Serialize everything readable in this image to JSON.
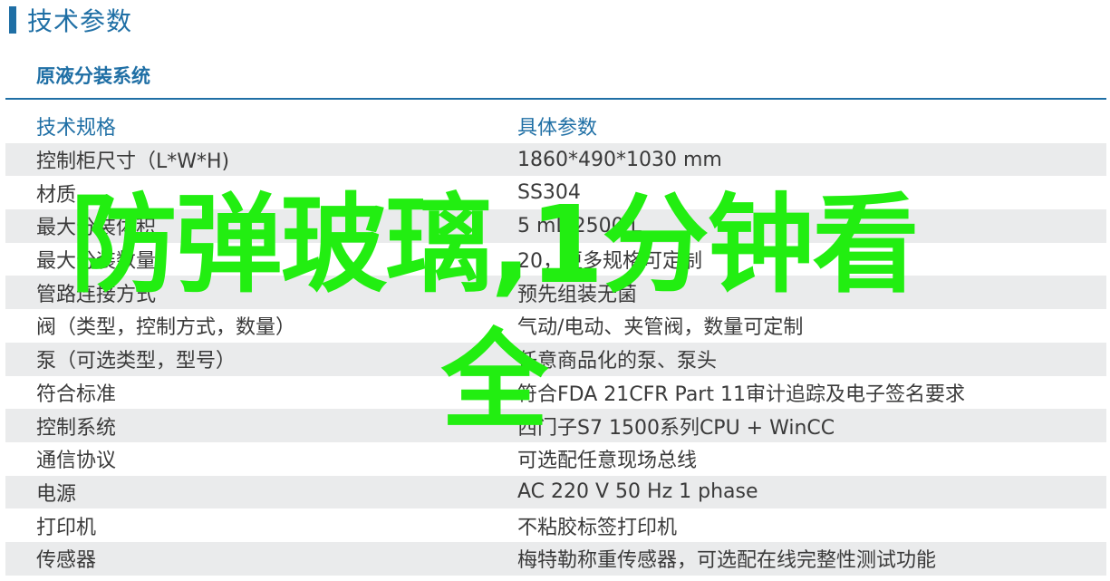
{
  "header": {
    "title": "技术参数"
  },
  "section": {
    "title": "原液分装系统"
  },
  "table": {
    "columns": [
      "技术规格",
      "具体参数"
    ],
    "rows": [
      [
        "控制柜尺寸（L*W*H)",
        "1860*490*1030 mm"
      ],
      [
        "材质",
        "SS304"
      ],
      [
        "最大分装体积",
        "5 mL 2500 L"
      ],
      [
        "最大分装数量",
        "20，更多规格可定制"
      ],
      [
        "管路连接方式",
        "预先组装无菌"
      ],
      [
        "阀（类型，控制方式，数量）",
        "气动/电动、夹管阀，数量可定制"
      ],
      [
        "泵（可选类型，型号）",
        "任意商品化的泵、泵头"
      ],
      [
        "符合标准",
        "符合FDA 21CFR Part 11审计追踪及电子签名要求"
      ],
      [
        "控制系统",
        "西门子S7 1500系列CPU + WinCC"
      ],
      [
        "通信协议",
        "可选配任意现场总线"
      ],
      [
        "电源",
        "AC 220 V 50 Hz 1 phase"
      ],
      [
        "打印机",
        "不粘胶标签打印机"
      ],
      [
        "传感器",
        "梅特勒称重传感器，可选配在线完整性测试功能"
      ]
    ]
  },
  "overlay": {
    "text": "防弹玻璃,1分钟看全",
    "color": "#22ee11"
  },
  "colors": {
    "accent": "#1f6fa5",
    "row_shade": "#eaebec",
    "text": "#3a3a3a"
  }
}
